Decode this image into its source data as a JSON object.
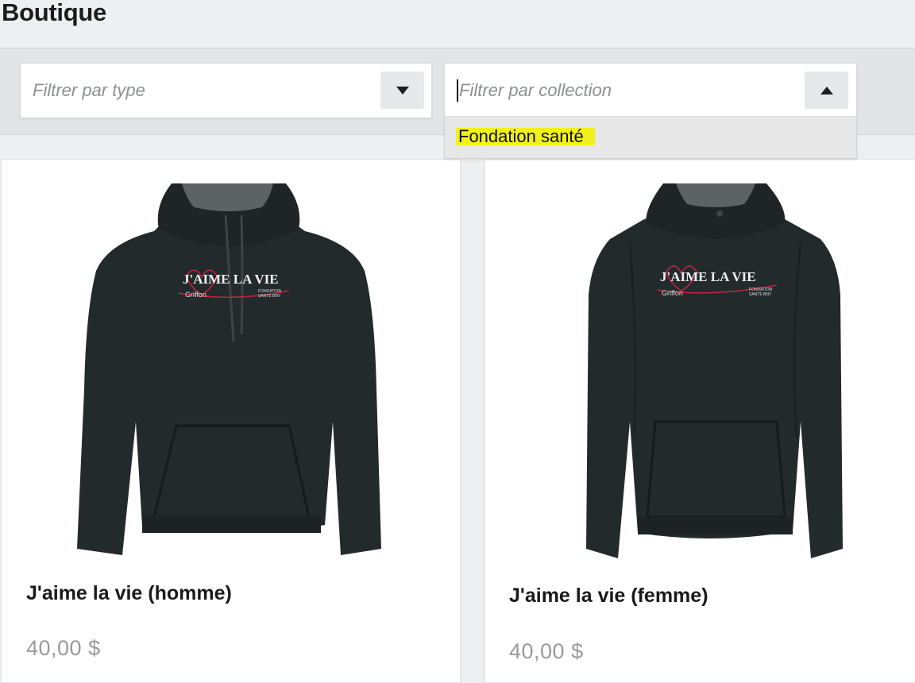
{
  "page": {
    "title": "Boutique"
  },
  "filters": {
    "type": {
      "placeholder": "Filtrer par type",
      "toggle_icon": "chevron-down-icon"
    },
    "collection": {
      "placeholder": "Filtrer par collection",
      "toggle_icon": "chevron-up-icon",
      "options": [
        "Fondation santé"
      ],
      "highlight_color": "#f2f21a"
    }
  },
  "products": [
    {
      "name": "J'aime la vie (homme)",
      "price": "40,00 $",
      "image": {
        "icon": "hoodie-men-icon",
        "logo_text": "J'AIME LA VIE",
        "logo_sub_left": "Griffon",
        "logo_sub_right_1": "FONDATION",
        "logo_sub_right_2": "SANTÉ BNY"
      }
    },
    {
      "name": "J'aime la vie (femme)",
      "price": "40,00 $",
      "image": {
        "icon": "hoodie-women-icon",
        "logo_text": "J'AIME LA VIE",
        "logo_sub_left": "Griffon",
        "logo_sub_right_1": "FONDATION",
        "logo_sub_right_2": "SANTÉ BNY"
      }
    }
  ],
  "colors": {
    "hoodie": "#232a2c",
    "hood_lining": "#5d6365",
    "logo_heart": "#c0243f",
    "price": "#9a9a9a"
  }
}
